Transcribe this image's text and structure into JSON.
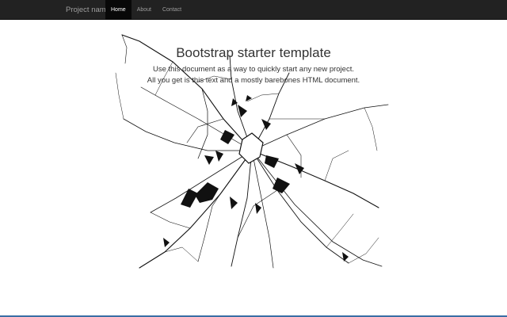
{
  "navbar": {
    "brand": "Project name",
    "items": [
      {
        "label": "Home",
        "active": true
      },
      {
        "label": "About",
        "active": false
      },
      {
        "label": "Contact",
        "active": false
      }
    ]
  },
  "main": {
    "title": "Bootstrap starter template",
    "lead_lines": [
      "Use this document as a way to quickly start any new project.",
      "All you get is this text and a mostly barebones HTML document."
    ]
  },
  "overlay": {
    "icon": "shattered-glass-icon",
    "crack_color": "#111111"
  },
  "colors": {
    "navbar_bg": "#222222",
    "navbar_active_bg": "#080808",
    "navbar_text": "#9d9d9d",
    "navbar_active_text": "#ffffff",
    "body_text": "#333333"
  }
}
